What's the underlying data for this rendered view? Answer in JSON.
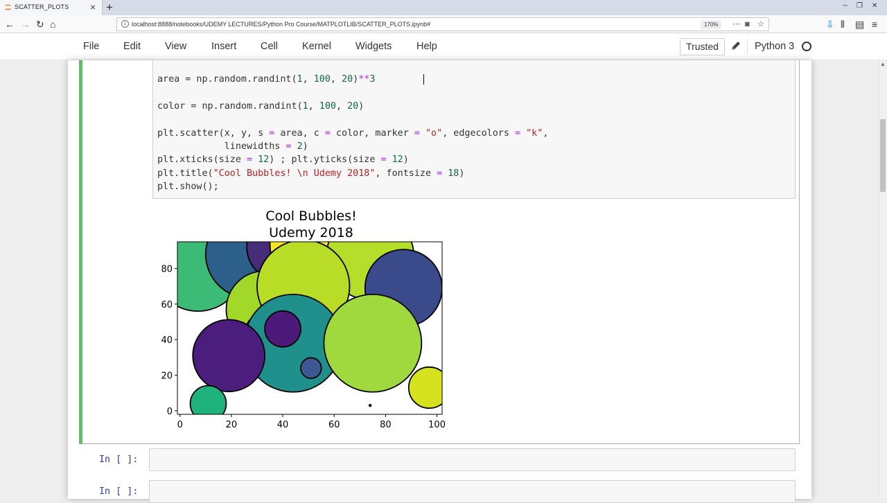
{
  "browser": {
    "tab_title": "SCATTER_PLOTS",
    "url": "localhost:8888/notebooks/UDEMY LECTURES/Python Pro Course/MATPLOTLIB/SCATTER_PLOTS.ipynb#",
    "zoom": "170%",
    "icons": [
      "back-icon",
      "forward-icon",
      "reload-icon",
      "home-icon",
      "info-icon",
      "more-icon",
      "pocket-icon",
      "bookmark-star-icon",
      "download-icon",
      "library-icon",
      "sidebar-icon",
      "menu-icon"
    ]
  },
  "menubar": {
    "items": [
      "File",
      "Edit",
      "View",
      "Insert",
      "Cell",
      "Kernel",
      "Widgets",
      "Help"
    ],
    "trusted": "Trusted",
    "kernel": "Python 3"
  },
  "code": {
    "line1": {
      "a": "area = np.random.randint(",
      "n1": "1",
      "b": ", ",
      "n2": "100",
      "c": ", ",
      "n3": "20",
      "d": ")",
      "op": "**",
      "n4": "3"
    },
    "line2": {
      "a": "color = np.random.randint(",
      "n1": "1",
      "b": ", ",
      "n2": "100",
      "c": ", ",
      "n3": "20",
      "d": ")"
    },
    "line3": {
      "a": "plt.scatter(x, y, s ",
      "eq1": "=",
      "b": " area, c ",
      "eq2": "=",
      "c": " color, marker ",
      "eq3": "=",
      "sp": " ",
      "s1": "\"o\"",
      "d": ", edgecolors ",
      "eq4": "=",
      "sp2": " ",
      "s2": "\"k\"",
      "e": ","
    },
    "line4": {
      "a": "            linewidths ",
      "eq": "=",
      "sp": " ",
      "n": "2",
      "b": ")"
    },
    "line5": {
      "a": "plt.xticks(size ",
      "eq1": "=",
      "sp1": " ",
      "n1": "12",
      "b": ") ; plt.yticks(size ",
      "eq2": "=",
      "sp2": " ",
      "n2": "12",
      "c": ")"
    },
    "line6": {
      "a": "plt.title(",
      "s": "\"Cool Bubbles! \\n Udemy 2018\"",
      "b": ", fontsize ",
      "eq": "=",
      "sp": " ",
      "n": "18",
      "c": ")"
    },
    "line7": {
      "a": "plt.show();"
    }
  },
  "prompts": [
    "In [ ]:",
    "In [ ]:"
  ],
  "chart_data": {
    "type": "scatter",
    "title": "Cool Bubbles!\nUdemy 2018",
    "title_lines": [
      "Cool Bubbles!",
      "Udemy 2018"
    ],
    "xlim": [
      -1,
      102
    ],
    "ylim": [
      -2,
      95
    ],
    "xticks": [
      0,
      20,
      40,
      60,
      80,
      100
    ],
    "yticks": [
      0,
      20,
      40,
      60,
      80
    ],
    "marker": "o",
    "edgecolor": "#000000",
    "linewidth": 2,
    "points": [
      {
        "x": 7,
        "y": 82,
        "r": 18,
        "color": "#3bbb75"
      },
      {
        "x": 27,
        "y": 88,
        "r": 17,
        "color": "#2c5f8a"
      },
      {
        "x": 39,
        "y": 92,
        "r": 13,
        "color": "#472c7a"
      },
      {
        "x": 56,
        "y": 94,
        "r": 21,
        "color": "#fde725"
      },
      {
        "x": 74,
        "y": 87,
        "r": 17,
        "color": "#b5de2b"
      },
      {
        "x": 87,
        "y": 69,
        "r": 15,
        "color": "#3b4a8b"
      },
      {
        "x": 33,
        "y": 57,
        "r": 15,
        "color": "#a2d82a"
      },
      {
        "x": 48,
        "y": 70,
        "r": 18,
        "color": "#b9dc27"
      },
      {
        "x": 30,
        "y": 47,
        "r": 4,
        "color": "#a7d838"
      },
      {
        "x": 44,
        "y": 38,
        "r": 19,
        "color": "#1f908b"
      },
      {
        "x": 40,
        "y": 46,
        "r": 7,
        "color": "#4d1a7a"
      },
      {
        "x": 19,
        "y": 31,
        "r": 14,
        "color": "#4b1d7c"
      },
      {
        "x": 75,
        "y": 38,
        "r": 19,
        "color": "#a0d93e"
      },
      {
        "x": 51,
        "y": 24,
        "r": 4,
        "color": "#3c5791"
      },
      {
        "x": 97,
        "y": 13,
        "r": 8,
        "color": "#d6e21e"
      },
      {
        "x": 11,
        "y": 4,
        "r": 7,
        "color": "#20b27c"
      },
      {
        "x": 74,
        "y": 3,
        "r": 0.6,
        "color": "#000000"
      }
    ]
  }
}
